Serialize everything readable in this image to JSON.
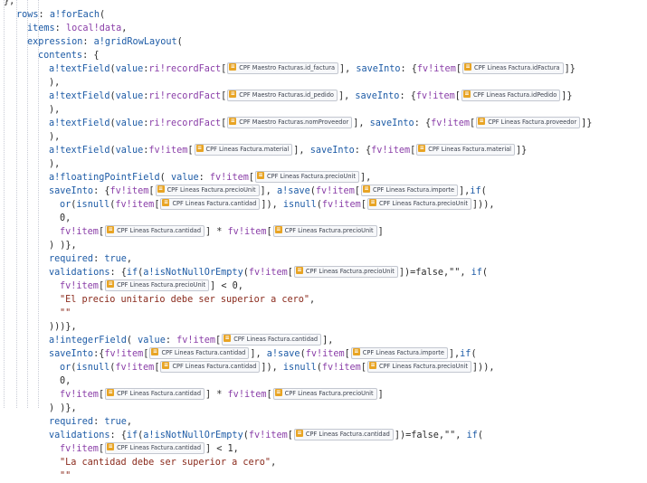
{
  "colors": {
    "keyword": "#1d5ba6",
    "reference": "#8a3ea8",
    "string": "#8a2a1c",
    "plain": "#2b2b2b",
    "chip_icon": "#e8a424",
    "chip_border": "#c3c7d0",
    "indent_guide": "#c9ccd6"
  },
  "chip_icon": "record-type-icon",
  "lines": [
    [
      [
        "pl",
        "},"
      ]
    ],
    [
      [
        "kw",
        "rows"
      ],
      [
        "pl",
        ": "
      ],
      [
        "fn",
        "a!forEach"
      ],
      [
        "pl",
        "("
      ]
    ],
    [
      [
        "kw",
        "items"
      ],
      [
        "pl",
        ": "
      ],
      [
        "ref",
        "local!data"
      ],
      [
        "pl",
        ","
      ]
    ],
    [
      [
        "kw",
        "expression"
      ],
      [
        "pl",
        ": "
      ],
      [
        "fn",
        "a!gridRowLayout"
      ],
      [
        "pl",
        "("
      ]
    ],
    [
      [
        "kw",
        "contents"
      ],
      [
        "pl",
        ": {"
      ]
    ],
    [
      [
        "fn",
        "a!textField"
      ],
      [
        "pl",
        "("
      ],
      [
        "kw",
        "value"
      ],
      [
        "pl",
        ":"
      ],
      [
        "ref",
        "ri!recordFact"
      ],
      [
        "pl",
        "["
      ],
      [
        "chip",
        "CPF Maestro Facturas.id_factura"
      ],
      [
        "pl",
        "], "
      ],
      [
        "kw",
        "saveInto"
      ],
      [
        "pl",
        ": {"
      ],
      [
        "ref",
        "fv!item"
      ],
      [
        "pl",
        "["
      ],
      [
        "chip",
        "CPF Lineas Factura.idFactura"
      ],
      [
        "pl",
        "]}"
      ]
    ],
    [
      [
        "pl",
        "),"
      ]
    ],
    [
      [
        "fn",
        "a!textField"
      ],
      [
        "pl",
        "("
      ],
      [
        "kw",
        "value"
      ],
      [
        "pl",
        ":"
      ],
      [
        "ref",
        "ri!recordFact"
      ],
      [
        "pl",
        "["
      ],
      [
        "chip",
        "CPF Maestro Facturas.id_pedido"
      ],
      [
        "pl",
        "], "
      ],
      [
        "kw",
        "saveInto"
      ],
      [
        "pl",
        ": {"
      ],
      [
        "ref",
        "fv!item"
      ],
      [
        "pl",
        "["
      ],
      [
        "chip",
        "CPF Lineas Factura.idPedido"
      ],
      [
        "pl",
        "]}"
      ]
    ],
    [
      [
        "pl",
        "),"
      ]
    ],
    [
      [
        "fn",
        "a!textField"
      ],
      [
        "pl",
        "("
      ],
      [
        "kw",
        "value"
      ],
      [
        "pl",
        ":"
      ],
      [
        "ref",
        "ri!recordFact"
      ],
      [
        "pl",
        "["
      ],
      [
        "chip",
        "CPF Maestro Facturas.nomProveedor"
      ],
      [
        "pl",
        "], "
      ],
      [
        "kw",
        "saveInto"
      ],
      [
        "pl",
        ": {"
      ],
      [
        "ref",
        "fv!item"
      ],
      [
        "pl",
        "["
      ],
      [
        "chip",
        "CPF Lineas Factura.proveedor"
      ],
      [
        "pl",
        "]}"
      ]
    ],
    [
      [
        "pl",
        "),"
      ]
    ],
    [
      [
        "fn",
        "a!textField"
      ],
      [
        "pl",
        "("
      ],
      [
        "kw",
        "value"
      ],
      [
        "pl",
        ":"
      ],
      [
        "ref",
        "fv!item"
      ],
      [
        "pl",
        "["
      ],
      [
        "chip",
        "CPF Lineas Factura.material"
      ],
      [
        "pl",
        "], "
      ],
      [
        "kw",
        "saveInto"
      ],
      [
        "pl",
        ": {"
      ],
      [
        "ref",
        "fv!item"
      ],
      [
        "pl",
        "["
      ],
      [
        "chip",
        "CPF Lineas Factura.material"
      ],
      [
        "pl",
        "]}"
      ]
    ],
    [
      [
        "pl",
        "),"
      ]
    ],
    [
      [
        "fn",
        "a!floatingPointField"
      ],
      [
        "pl",
        "( "
      ],
      [
        "kw",
        "value"
      ],
      [
        "pl",
        ": "
      ],
      [
        "ref",
        "fv!item"
      ],
      [
        "pl",
        "["
      ],
      [
        "chip",
        "CPF Lineas Factura.precioUnit"
      ],
      [
        "pl",
        "],"
      ]
    ],
    [
      [
        "kw",
        "saveInto"
      ],
      [
        "pl",
        ": {"
      ],
      [
        "ref",
        "fv!item"
      ],
      [
        "pl",
        "["
      ],
      [
        "chip",
        "CPF Lineas Factura.precioUnit"
      ],
      [
        "pl",
        "], "
      ],
      [
        "fn",
        "a!save"
      ],
      [
        "pl",
        "("
      ],
      [
        "ref",
        "fv!item"
      ],
      [
        "pl",
        "["
      ],
      [
        "chip",
        "CPF Lineas Factura.importe"
      ],
      [
        "pl",
        "],"
      ],
      [
        "fn",
        "if"
      ],
      [
        "pl",
        "("
      ]
    ],
    [
      [
        "fn",
        "or"
      ],
      [
        "pl",
        "("
      ],
      [
        "fn",
        "isnull"
      ],
      [
        "pl",
        "("
      ],
      [
        "ref",
        "fv!item"
      ],
      [
        "pl",
        "["
      ],
      [
        "chip",
        "CPF Lineas Factura.cantidad"
      ],
      [
        "pl",
        "]), "
      ],
      [
        "fn",
        "isnull"
      ],
      [
        "pl",
        "("
      ],
      [
        "ref",
        "fv!item"
      ],
      [
        "pl",
        "["
      ],
      [
        "chip",
        "CPF Lineas Factura.precioUnit"
      ],
      [
        "pl",
        "])),"
      ]
    ],
    [
      [
        "pl",
        "0,"
      ]
    ],
    [
      [
        "ref",
        "fv!item"
      ],
      [
        "pl",
        "["
      ],
      [
        "chip",
        "CPF Lineas Factura.cantidad"
      ],
      [
        "pl",
        "] * "
      ],
      [
        "ref",
        "fv!item"
      ],
      [
        "pl",
        "["
      ],
      [
        "chip",
        "CPF Lineas Factura.precioUnit"
      ],
      [
        "pl",
        "]"
      ]
    ],
    [
      [
        "pl",
        ") )},"
      ]
    ],
    [
      [
        "kw",
        "required"
      ],
      [
        "pl",
        ": "
      ],
      [
        "kw",
        "true"
      ],
      [
        "pl",
        ","
      ]
    ],
    [
      [
        "kw",
        "validations"
      ],
      [
        "pl",
        ": {"
      ],
      [
        "fn",
        "if"
      ],
      [
        "pl",
        "("
      ],
      [
        "fn",
        "a!isNotNullOrEmpty"
      ],
      [
        "pl",
        "("
      ],
      [
        "ref",
        "fv!item"
      ],
      [
        "pl",
        "["
      ],
      [
        "chip",
        "CPF Lineas Factura.precioUnit"
      ],
      [
        "pl",
        "])=false,\"\", "
      ],
      [
        "fn",
        "if"
      ],
      [
        "pl",
        "("
      ]
    ],
    [
      [
        "ref",
        "fv!item"
      ],
      [
        "pl",
        "["
      ],
      [
        "chip",
        "CPF Lineas Factura.precioUnit"
      ],
      [
        "pl",
        "] < 0,"
      ]
    ],
    [
      [
        "str",
        "\"El precio unitario debe ser superior a cero\""
      ],
      [
        "pl",
        ","
      ]
    ],
    [
      [
        "str",
        "\"\""
      ]
    ],
    [
      [
        "pl",
        ")))},"
      ]
    ],
    [
      [
        "fn",
        "a!integerField"
      ],
      [
        "pl",
        "( "
      ],
      [
        "kw",
        "value"
      ],
      [
        "pl",
        ": "
      ],
      [
        "ref",
        "fv!item"
      ],
      [
        "pl",
        "["
      ],
      [
        "chip",
        "CPF Lineas Factura.cantidad"
      ],
      [
        "pl",
        "],"
      ]
    ],
    [
      [
        "kw",
        "saveInto"
      ],
      [
        "pl",
        ":{"
      ],
      [
        "ref",
        "fv!item"
      ],
      [
        "pl",
        "["
      ],
      [
        "chip",
        "CPF Lineas Factura.cantidad"
      ],
      [
        "pl",
        "], "
      ],
      [
        "fn",
        "a!save"
      ],
      [
        "pl",
        "("
      ],
      [
        "ref",
        "fv!item"
      ],
      [
        "pl",
        "["
      ],
      [
        "chip",
        "CPF Lineas Factura.importe"
      ],
      [
        "pl",
        "],"
      ],
      [
        "fn",
        "if"
      ],
      [
        "pl",
        "("
      ]
    ],
    [
      [
        "fn",
        "or"
      ],
      [
        "pl",
        "("
      ],
      [
        "fn",
        "isnull"
      ],
      [
        "pl",
        "("
      ],
      [
        "ref",
        "fv!item"
      ],
      [
        "pl",
        "["
      ],
      [
        "chip",
        "CPF Lineas Factura.cantidad"
      ],
      [
        "pl",
        "]), "
      ],
      [
        "fn",
        "isnull"
      ],
      [
        "pl",
        "("
      ],
      [
        "ref",
        "fv!item"
      ],
      [
        "pl",
        "["
      ],
      [
        "chip",
        "CPF Lineas Factura.precioUnit"
      ],
      [
        "pl",
        "])),"
      ]
    ],
    [
      [
        "pl",
        "0,"
      ]
    ],
    [
      [
        "ref",
        "fv!item"
      ],
      [
        "pl",
        "["
      ],
      [
        "chip",
        "CPF Lineas Factura.cantidad"
      ],
      [
        "pl",
        "] * "
      ],
      [
        "ref",
        "fv!item"
      ],
      [
        "pl",
        "["
      ],
      [
        "chip",
        "CPF Lineas Factura.precioUnit"
      ],
      [
        "pl",
        "]"
      ]
    ],
    [
      [
        "pl",
        ") )},"
      ]
    ],
    [
      [
        "kw",
        "required"
      ],
      [
        "pl",
        ": "
      ],
      [
        "kw",
        "true"
      ],
      [
        "pl",
        ","
      ]
    ],
    [
      [
        "kw",
        "validations"
      ],
      [
        "pl",
        ": {"
      ],
      [
        "fn",
        "if"
      ],
      [
        "pl",
        "("
      ],
      [
        "fn",
        "a!isNotNullOrEmpty"
      ],
      [
        "pl",
        "("
      ],
      [
        "ref",
        "fv!item"
      ],
      [
        "pl",
        "["
      ],
      [
        "chip",
        "CPF Lineas Factura.cantidad"
      ],
      [
        "pl",
        "])=false,\"\", "
      ],
      [
        "fn",
        "if"
      ],
      [
        "pl",
        "("
      ]
    ],
    [
      [
        "ref",
        "fv!item"
      ],
      [
        "pl",
        "["
      ],
      [
        "chip",
        "CPF Lineas Factura.cantidad"
      ],
      [
        "pl",
        "] < 1,"
      ]
    ],
    [
      [
        "str",
        "\"La cantidad debe ser superior a cero\""
      ],
      [
        "pl",
        ","
      ]
    ],
    [
      [
        "str",
        "\"\""
      ]
    ]
  ]
}
